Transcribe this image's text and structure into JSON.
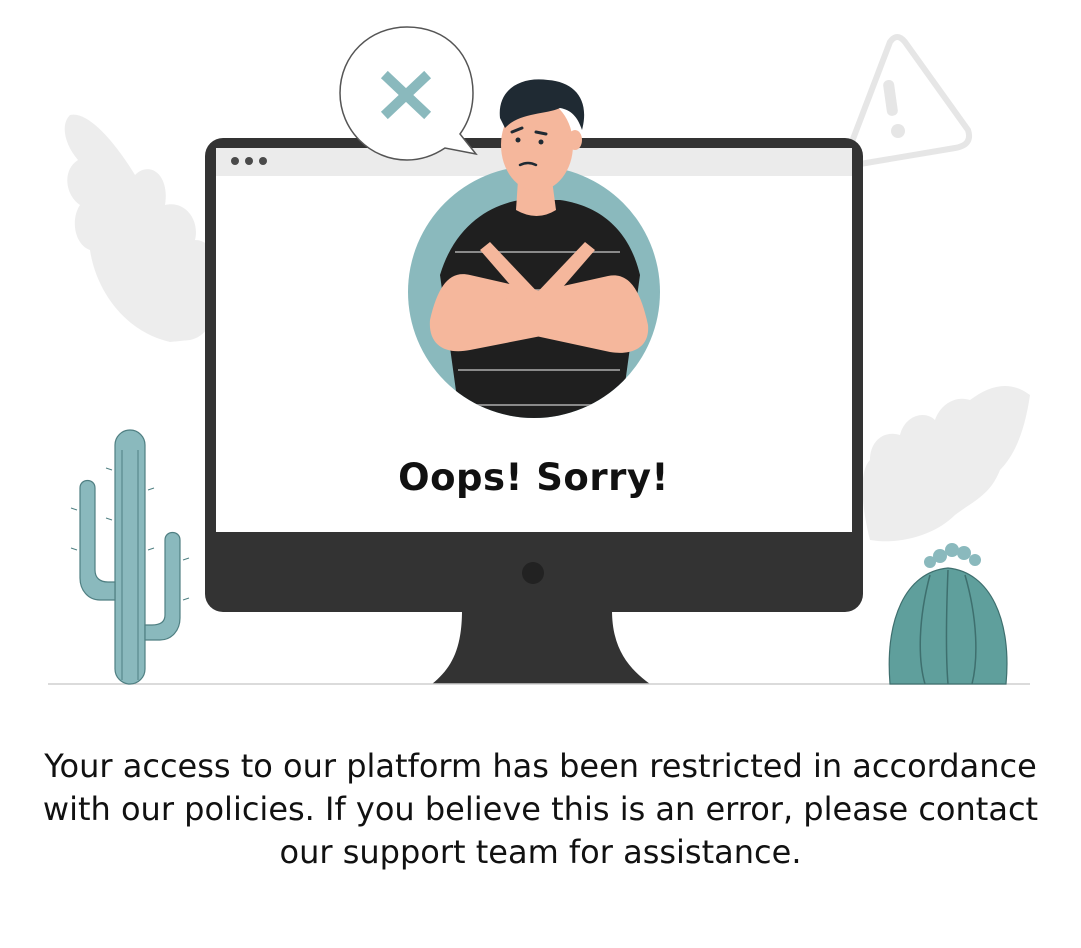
{
  "error_screen": {
    "heading": "Oops! Sorry!",
    "message": "Your access to our platform has been restricted in accordance with our policies. If you believe this is an error, please contact our support team for assistance."
  },
  "colors": {
    "teal": "#8ab9bd",
    "teal_dark": "#6aa5a7",
    "monitor": "#333333",
    "ghost": "#ececec",
    "skin": "#f5b79c"
  },
  "icons": {
    "speech_bubble": "close-x-icon",
    "warning": "warning-triangle-icon",
    "window_controls": "three-dots-icon"
  }
}
